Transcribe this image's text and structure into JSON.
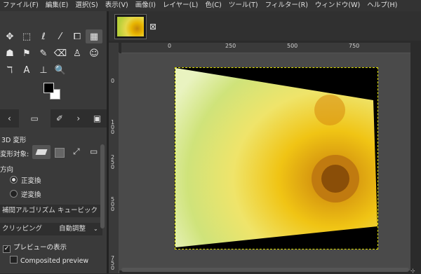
{
  "menu": [
    "ファイル(F)",
    "編集(E)",
    "選択(S)",
    "表示(V)",
    "画像(I)",
    "レイヤー(L)",
    "色(C)",
    "ツール(T)",
    "フィルター(R)",
    "ウィンドウ(W)",
    "ヘルプ(H)"
  ],
  "tools": {
    "row1": [
      "✥",
      "⬚",
      "ℓ",
      "⁄",
      "⧠",
      "▦"
    ],
    "row2": [
      "☗",
      "⚑",
      "✎",
      "⌫",
      "♙",
      "☺"
    ],
    "row3": [
      "ℸ",
      "A",
      "⊥",
      "🔍"
    ]
  },
  "dock_tabs": [
    "‹",
    "▭",
    "✐",
    "›",
    "▣"
  ],
  "tool_options": {
    "title": "3D 変形",
    "transform_target_label": "変形対象:",
    "direction_label": "方向",
    "direction_forward": "正変換",
    "direction_backward": "逆変換",
    "interpolation_label": "補間アルゴリズム",
    "interpolation_value": "キュービック",
    "clipping_label": "クリッピング",
    "clipping_value": "自動調整",
    "show_preview": "プレビューの表示",
    "composited_preview": "Composited preview"
  },
  "image_tab": {
    "close_icon": "⊠"
  },
  "ruler": {
    "h_labels": [
      "0",
      "250",
      "500",
      "750"
    ],
    "v_labels": [
      "0",
      "1\n0\n0",
      "2\n5\n0",
      "5\n0\n0",
      "7\n5\n0"
    ]
  }
}
